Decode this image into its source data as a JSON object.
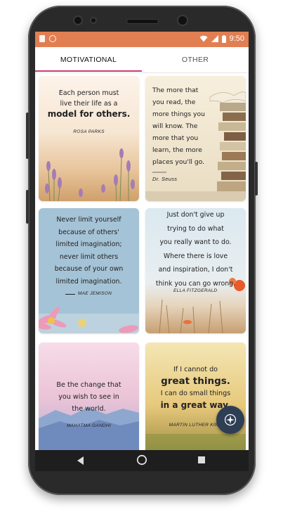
{
  "status_bar": {
    "time": "9:50"
  },
  "tabs": [
    {
      "label": "MOTIVATIONAL",
      "active": true
    },
    {
      "label": "OTHER",
      "active": false
    }
  ],
  "cards": [
    {
      "lines": [
        "Each person must",
        "live their life as a",
        "model for others."
      ],
      "author": "ROSA PARKS"
    },
    {
      "lines": [
        "The more that",
        "you read, the",
        "more things you",
        "will know. The",
        "more that you",
        "learn, the more",
        "places you'll go."
      ],
      "author": "Dr. Seuss"
    },
    {
      "lines": [
        "Never limit yourself",
        "because of others'",
        "limited imagination;",
        "never limit others",
        "because of your own",
        "limited imagination."
      ],
      "author": "MAE JEMISON"
    },
    {
      "lines": [
        "Just don't give up",
        "trying to do what",
        "you really want to do.",
        "Where there is love",
        "and inspiration, I don't",
        "think you can go wrong."
      ],
      "author": "ELLA FITZGERALD"
    },
    {
      "lines": [
        "Be the change that",
        "you wish to see in",
        "the world."
      ],
      "author": "MAHATMA GANDHI"
    },
    {
      "lines": [
        "If I cannot do",
        "great things.",
        "I can do small things",
        "in a great way."
      ],
      "author": "MARTIN LUTHER KING"
    }
  ],
  "fab": {
    "icon": "compass-icon"
  },
  "nav": {
    "back_icon": "back-triangle-icon",
    "home_icon": "home-circle-icon",
    "recents_icon": "recents-square-icon"
  },
  "colors": {
    "status_bar": "#e17f52",
    "tab_indicator": "#d23a6e",
    "fab": "#2e3e55"
  }
}
